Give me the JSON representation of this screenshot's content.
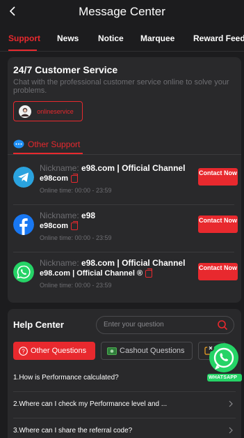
{
  "header": {
    "title": "Message Center"
  },
  "tabs": [
    {
      "label": "Support",
      "active": true
    },
    {
      "label": "News",
      "active": false
    },
    {
      "label": "Notice",
      "active": false
    },
    {
      "label": "Marquee",
      "active": false
    },
    {
      "label": "Reward Feedback",
      "active": false
    }
  ],
  "customer_service": {
    "title": "24/7 Customer Service",
    "description": "Chat with the professional customer service online to solve your problems.",
    "online_button": "onlineservice",
    "other_support_label": "Other Support"
  },
  "contacts": [
    {
      "icon": "telegram-icon",
      "nick_label": "Nickname:",
      "nickname": "e98.com | Official Channel",
      "handle": "e98com",
      "online_time": "Online time: 00:00 - 23:59",
      "button": "Contact Now"
    },
    {
      "icon": "facebook-icon",
      "nick_label": "Nickname:",
      "nickname": "e98",
      "handle": "e98com",
      "online_time": "Online time: 00:00 - 23:59",
      "button": "Contact Now"
    },
    {
      "icon": "whatsapp-icon",
      "nick_label": "Nickname:",
      "nickname": "e98.com | Official Channel",
      "handle": "e98.com | Official Channel ®",
      "online_time": "Online time: 00:00 - 23:59",
      "button": "Contact Now"
    }
  ],
  "help_center": {
    "title": "Help Center",
    "search_placeholder": "Enter your question",
    "chips": [
      {
        "label": "Other Questions",
        "active": true
      },
      {
        "label": "Cashout Questions",
        "active": false
      }
    ],
    "questions": [
      "1.How is Performance calculated?",
      "2.Where can I check my Performance level and ...",
      "3.Where can I share the referral code?"
    ]
  },
  "floating_whatsapp": {
    "label": "WHATSAPP"
  },
  "colors": {
    "accent": "#e8292e",
    "background": "#1c1c1e",
    "card": "#29292b",
    "muted": "#6e6e72"
  }
}
